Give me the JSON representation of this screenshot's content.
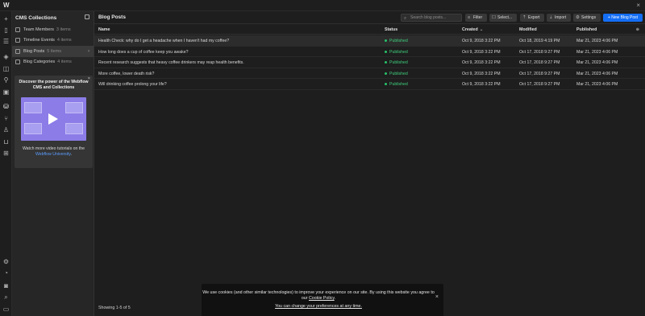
{
  "app": {
    "logo": "W",
    "close": "×"
  },
  "iconbar": [
    {
      "name": "add-panel-icon",
      "glyph": "+"
    },
    {
      "name": "pages-icon",
      "glyph": "▯"
    },
    {
      "name": "navigator-icon",
      "glyph": "☰"
    },
    {
      "name": "components-icon",
      "glyph": "◈"
    },
    {
      "name": "variables-icon",
      "glyph": "◫"
    },
    {
      "name": "style-selectors-icon",
      "glyph": "⚲"
    },
    {
      "name": "assets-icon",
      "glyph": "▣"
    },
    {
      "name": "cms-icon",
      "glyph": "⛁"
    },
    {
      "name": "logic-icon",
      "glyph": "⑂"
    },
    {
      "name": "users-icon",
      "glyph": "♙"
    },
    {
      "name": "ecommerce-icon",
      "glyph": "⊔"
    },
    {
      "name": "apps-icon",
      "glyph": "⊞"
    },
    {
      "name": "settings-icon",
      "glyph": "⚙"
    },
    {
      "name": "audit-icon",
      "glyph": "◔"
    },
    {
      "name": "record-icon",
      "glyph": "◙"
    },
    {
      "name": "search-icon",
      "glyph": "⌕"
    },
    {
      "name": "video-tutorials-icon",
      "glyph": "▭"
    }
  ],
  "sidebar": {
    "title": "CMS Collections",
    "items": [
      {
        "label": "Team Members",
        "count": "3 items"
      },
      {
        "label": "Timeline Events",
        "count": "4 items"
      },
      {
        "label": "Blog Posts",
        "count": "5 items",
        "chevron": "›"
      },
      {
        "label": "Blog Categories",
        "count": "4 items"
      }
    ],
    "promo": {
      "close": "×",
      "title": "Discover the power of the Webflow CMS and Collections",
      "text_before": "Watch more video tutorials on the",
      "link": "Webflow University",
      "text_after": "."
    }
  },
  "main": {
    "title": "Blog Posts",
    "search_placeholder": "Search blog posts...",
    "toolbar": {
      "filter": "Filter",
      "select": "Select...",
      "export": "Export",
      "import": "Import",
      "settings": "Settings",
      "new": "+ New Blog Post"
    },
    "columns": {
      "name": "Name",
      "status": "Status",
      "created": "Created",
      "sort": "⌄",
      "modified": "Modified",
      "published": "Published",
      "pin": "⊕"
    },
    "rows": [
      {
        "name": "Health Check: why do I get a headache when I haven't had my coffee?",
        "status": "Published",
        "created": "Oct 9, 2018 3:22 PM",
        "modified": "Oct 18, 2019 4:19 PM",
        "published": "Mar 21, 2023 4:06 PM"
      },
      {
        "name": "How long does a cup of coffee keep you awake?",
        "status": "Published",
        "created": "Oct 9, 2018 3:22 PM",
        "modified": "Oct 17, 2018 9:27 PM",
        "published": "Mar 21, 2023 4:06 PM"
      },
      {
        "name": "Recent research suggests that heavy coffee drinkers may reap health benefits.",
        "status": "Published",
        "created": "Oct 9, 2018 3:22 PM",
        "modified": "Oct 17, 2018 9:27 PM",
        "published": "Mar 21, 2023 4:06 PM"
      },
      {
        "name": "More coffee, lower death risk?",
        "status": "Published",
        "created": "Oct 9, 2018 3:22 PM",
        "modified": "Oct 17, 2018 9:27 PM",
        "published": "Mar 21, 2023 4:06 PM"
      },
      {
        "name": "Will drinking coffee prolong your life?",
        "status": "Published",
        "created": "Oct 9, 2018 3:22 PM",
        "modified": "Oct 17, 2018 9:27 PM",
        "published": "Mar 21, 2023 4:06 PM"
      }
    ],
    "footer": "Showing 1-5 of 5"
  },
  "cookie": {
    "line1": "We use cookies (and other similar technologies) to improve your experience on our site. By using this website you agree to",
    "line2_prefix": "our ",
    "policy_link": "Cookie Policy",
    "line2_suffix": ".",
    "preferences_link": "You can change your preferences at any time.",
    "close": "×"
  }
}
